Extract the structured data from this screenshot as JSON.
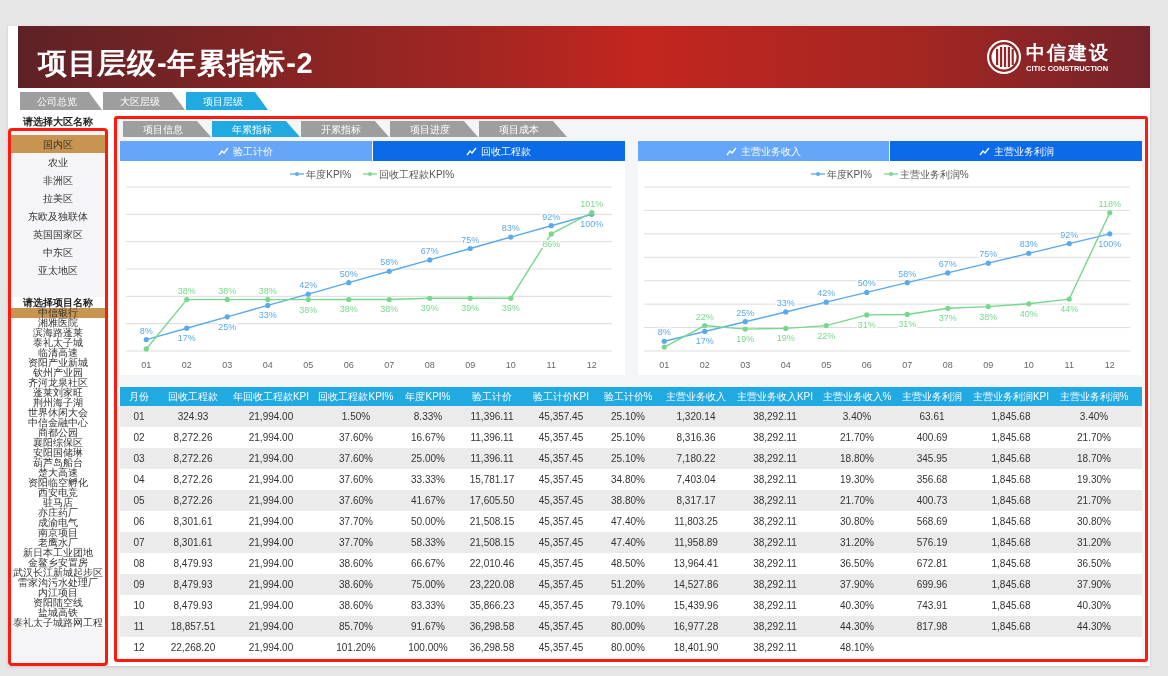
{
  "header": {
    "title": "项目层级-年累指标-2",
    "logo_cn": "中信建设",
    "logo_en": "CITIC CONSTRUCTION"
  },
  "top_tabs": [
    {
      "label": "公司总览",
      "selected": false
    },
    {
      "label": "大区层级",
      "selected": false
    },
    {
      "label": "项目层级",
      "selected": true
    }
  ],
  "sidebar": {
    "region_title": "请选择大区名称",
    "regions": [
      {
        "label": "国内区",
        "selected": true
      },
      {
        "label": "农业",
        "selected": false
      },
      {
        "label": "非洲区",
        "selected": false
      },
      {
        "label": "拉美区",
        "selected": false
      },
      {
        "label": "东欧及独联体",
        "selected": false
      },
      {
        "label": "英国国家区",
        "selected": false
      },
      {
        "label": "中东区",
        "selected": false
      },
      {
        "label": "亚太地区",
        "selected": false
      }
    ],
    "project_title": "请选择项目名称",
    "projects": [
      {
        "label": "中信银行",
        "selected": true
      },
      {
        "label": "湘雅医院",
        "selected": false
      },
      {
        "label": "滨海路蓬莱",
        "selected": false
      },
      {
        "label": "泰礼太子城",
        "selected": false
      },
      {
        "label": "临清高速",
        "selected": false
      },
      {
        "label": "资阳产业新城",
        "selected": false
      },
      {
        "label": "钦州产业园",
        "selected": false
      },
      {
        "label": "齐河龙泉社区",
        "selected": false
      },
      {
        "label": "蓬莱刘家旺",
        "selected": false
      },
      {
        "label": "荆州海子湖",
        "selected": false
      },
      {
        "label": "世界休闲大会",
        "selected": false
      },
      {
        "label": "中信金融中心",
        "selected": false
      },
      {
        "label": "商都公园",
        "selected": false
      },
      {
        "label": "襄阳综保区",
        "selected": false
      },
      {
        "label": "安阳国储琳",
        "selected": false
      },
      {
        "label": "葫芦岛船台",
        "selected": false
      },
      {
        "label": "楚大高速",
        "selected": false
      },
      {
        "label": "资阳临空孵化",
        "selected": false
      },
      {
        "label": "西安电竞",
        "selected": false
      },
      {
        "label": "驻马店",
        "selected": false
      },
      {
        "label": "亦庄药厂",
        "selected": false
      },
      {
        "label": "成渝电气",
        "selected": false
      },
      {
        "label": "南京项目",
        "selected": false
      },
      {
        "label": "老鹰水厂",
        "selected": false
      },
      {
        "label": "新日本工业团地",
        "selected": false
      },
      {
        "label": "金鳌乡安置房",
        "selected": false
      },
      {
        "label": "武汉长江新城起步区",
        "selected": false
      },
      {
        "label": "雷家沟污水处理厂",
        "selected": false
      },
      {
        "label": "内江项目",
        "selected": false
      },
      {
        "label": "资阳陆空线",
        "selected": false
      },
      {
        "label": "盐城高铁",
        "selected": false
      },
      {
        "label": "泰礼太子城路网工程",
        "selected": false
      }
    ]
  },
  "sub_tabs": [
    {
      "label": "项目信息",
      "selected": false
    },
    {
      "label": "年累指标",
      "selected": true
    },
    {
      "label": "开累指标",
      "selected": false
    },
    {
      "label": "项目进度",
      "selected": false
    },
    {
      "label": "项目成本",
      "selected": false
    }
  ],
  "charts": [
    {
      "tabs": [
        {
          "label": "验工计价",
          "selected": false
        },
        {
          "label": "回收工程款",
          "selected": true
        }
      ],
      "chart_data": {
        "type": "line",
        "legend": "top",
        "categories": [
          "01",
          "02",
          "03",
          "04",
          "05",
          "06",
          "07",
          "08",
          "09",
          "10",
          "11",
          "12"
        ],
        "series": [
          {
            "name": "年度KPI%",
            "color": "#5aa9ea",
            "values": [
              8.33,
              16.67,
              25,
              33.33,
              41.67,
              50,
              58.33,
              66.67,
              75,
              83.33,
              91.67,
              100
            ],
            "value_labels": [
              "8%",
              "17%",
              "25%",
              "33%",
              "42%",
              "50%",
              "58%",
              "67%",
              "75%",
              "83%",
              "92%",
              "100%"
            ]
          },
          {
            "name": "回收工程款KPI%",
            "color": "#77d88a",
            "values": [
              1.5,
              37.6,
              37.6,
              37.6,
              37.6,
              37.7,
              37.7,
              38.6,
              38.6,
              38.6,
              85.7,
              101.2
            ],
            "value_labels": [
              null,
              "38%",
              "38%",
              "38%",
              "38%",
              "38%",
              "38%",
              "39%",
              "39%",
              "39%",
              "86%",
              "101%"
            ]
          }
        ]
      }
    },
    {
      "tabs": [
        {
          "label": "主营业务收入",
          "selected": false
        },
        {
          "label": "主营业务利润",
          "selected": true
        }
      ],
      "chart_data": {
        "type": "line",
        "legend": "top",
        "categories": [
          "01",
          "02",
          "03",
          "04",
          "05",
          "06",
          "07",
          "08",
          "09",
          "10",
          "11",
          "12"
        ],
        "series": [
          {
            "name": "年度KPI%",
            "color": "#5aa9ea",
            "values": [
              8.33,
              16.67,
              25,
              33.33,
              41.67,
              50,
              58.33,
              66.67,
              75,
              83.33,
              91.67,
              100
            ],
            "value_labels": [
              "8%",
              "17%",
              "25%",
              "33%",
              "42%",
              "50%",
              "58%",
              "67%",
              "75%",
              "83%",
              "92%",
              "100%"
            ]
          },
          {
            "name": "主营业务利润%",
            "color": "#77d88a",
            "values": [
              3.4,
              21.7,
              18.7,
              19.3,
              21.7,
              30.8,
              31.2,
              36.5,
              37.9,
              40.3,
              44.3,
              118
            ],
            "value_labels": [
              null,
              "22%",
              "19%",
              "19%",
              "22%",
              "31%",
              "31%",
              "37%",
              "38%",
              "40%",
              "44%",
              "118%"
            ]
          }
        ]
      }
    }
  ],
  "table": {
    "columns": [
      "月份",
      "回收工程款",
      "年回收工程款KPI",
      "回收工程款KPI%",
      "年度KPI%",
      "验工计价",
      "验工计价KPI",
      "验工计价%",
      "主营业务收入",
      "主营业务收入KPI",
      "主营业务收入%",
      "主营业务利润",
      "主营业务利润KPI",
      "主营业务利润%"
    ],
    "rows": [
      [
        "01",
        "324.93",
        "21,994.00",
        "1.50%",
        "8.33%",
        "11,396.11",
        "45,357.45",
        "25.10%",
        "1,320.14",
        "38,292.11",
        "3.40%",
        "63.61",
        "1,845.68",
        "3.40%"
      ],
      [
        "02",
        "8,272.26",
        "21,994.00",
        "37.60%",
        "16.67%",
        "11,396.11",
        "45,357.45",
        "25.10%",
        "8,316.36",
        "38,292.11",
        "21.70%",
        "400.69",
        "1,845.68",
        "21.70%"
      ],
      [
        "03",
        "8,272.26",
        "21,994.00",
        "37.60%",
        "25.00%",
        "11,396.11",
        "45,357.45",
        "25.10%",
        "7,180.22",
        "38,292.11",
        "18.80%",
        "345.95",
        "1,845.68",
        "18.70%"
      ],
      [
        "04",
        "8,272.26",
        "21,994.00",
        "37.60%",
        "33.33%",
        "15,781.17",
        "45,357.45",
        "34.80%",
        "7,403.04",
        "38,292.11",
        "19.30%",
        "356.68",
        "1,845.68",
        "19.30%"
      ],
      [
        "05",
        "8,272.26",
        "21,994.00",
        "37.60%",
        "41.67%",
        "17,605.50",
        "45,357.45",
        "38.80%",
        "8,317.17",
        "38,292.11",
        "21.70%",
        "400.73",
        "1,845.68",
        "21.70%"
      ],
      [
        "06",
        "8,301.61",
        "21,994.00",
        "37.70%",
        "50.00%",
        "21,508.15",
        "45,357.45",
        "47.40%",
        "11,803.25",
        "38,292.11",
        "30.80%",
        "568.69",
        "1,845.68",
        "30.80%"
      ],
      [
        "07",
        "8,301.61",
        "21,994.00",
        "37.70%",
        "58.33%",
        "21,508.15",
        "45,357.45",
        "47.40%",
        "11,958.89",
        "38,292.11",
        "31.20%",
        "576.19",
        "1,845.68",
        "31.20%"
      ],
      [
        "08",
        "8,479.93",
        "21,994.00",
        "38.60%",
        "66.67%",
        "22,010.46",
        "45,357.45",
        "48.50%",
        "13,964.41",
        "38,292.11",
        "36.50%",
        "672.81",
        "1,845.68",
        "36.50%"
      ],
      [
        "09",
        "8,479.93",
        "21,994.00",
        "38.60%",
        "75.00%",
        "23,220.08",
        "45,357.45",
        "51.20%",
        "14,527.86",
        "38,292.11",
        "37.90%",
        "699.96",
        "1,845.68",
        "37.90%"
      ],
      [
        "10",
        "8,479.93",
        "21,994.00",
        "38.60%",
        "83.33%",
        "35,866.23",
        "45,357.45",
        "79.10%",
        "15,439.96",
        "38,292.11",
        "40.30%",
        "743.91",
        "1,845.68",
        "40.30%"
      ],
      [
        "11",
        "18,857.51",
        "21,994.00",
        "85.70%",
        "91.67%",
        "36,298.58",
        "45,357.45",
        "80.00%",
        "16,977.28",
        "38,292.11",
        "44.30%",
        "817.98",
        "1,845.68",
        "44.30%"
      ],
      [
        "12",
        "22,268.20",
        "21,994.00",
        "101.20%",
        "100.00%",
        "36,298.58",
        "45,357.45",
        "80.00%",
        "18,401.90",
        "38,292.11",
        "48.10%"
      ]
    ]
  }
}
